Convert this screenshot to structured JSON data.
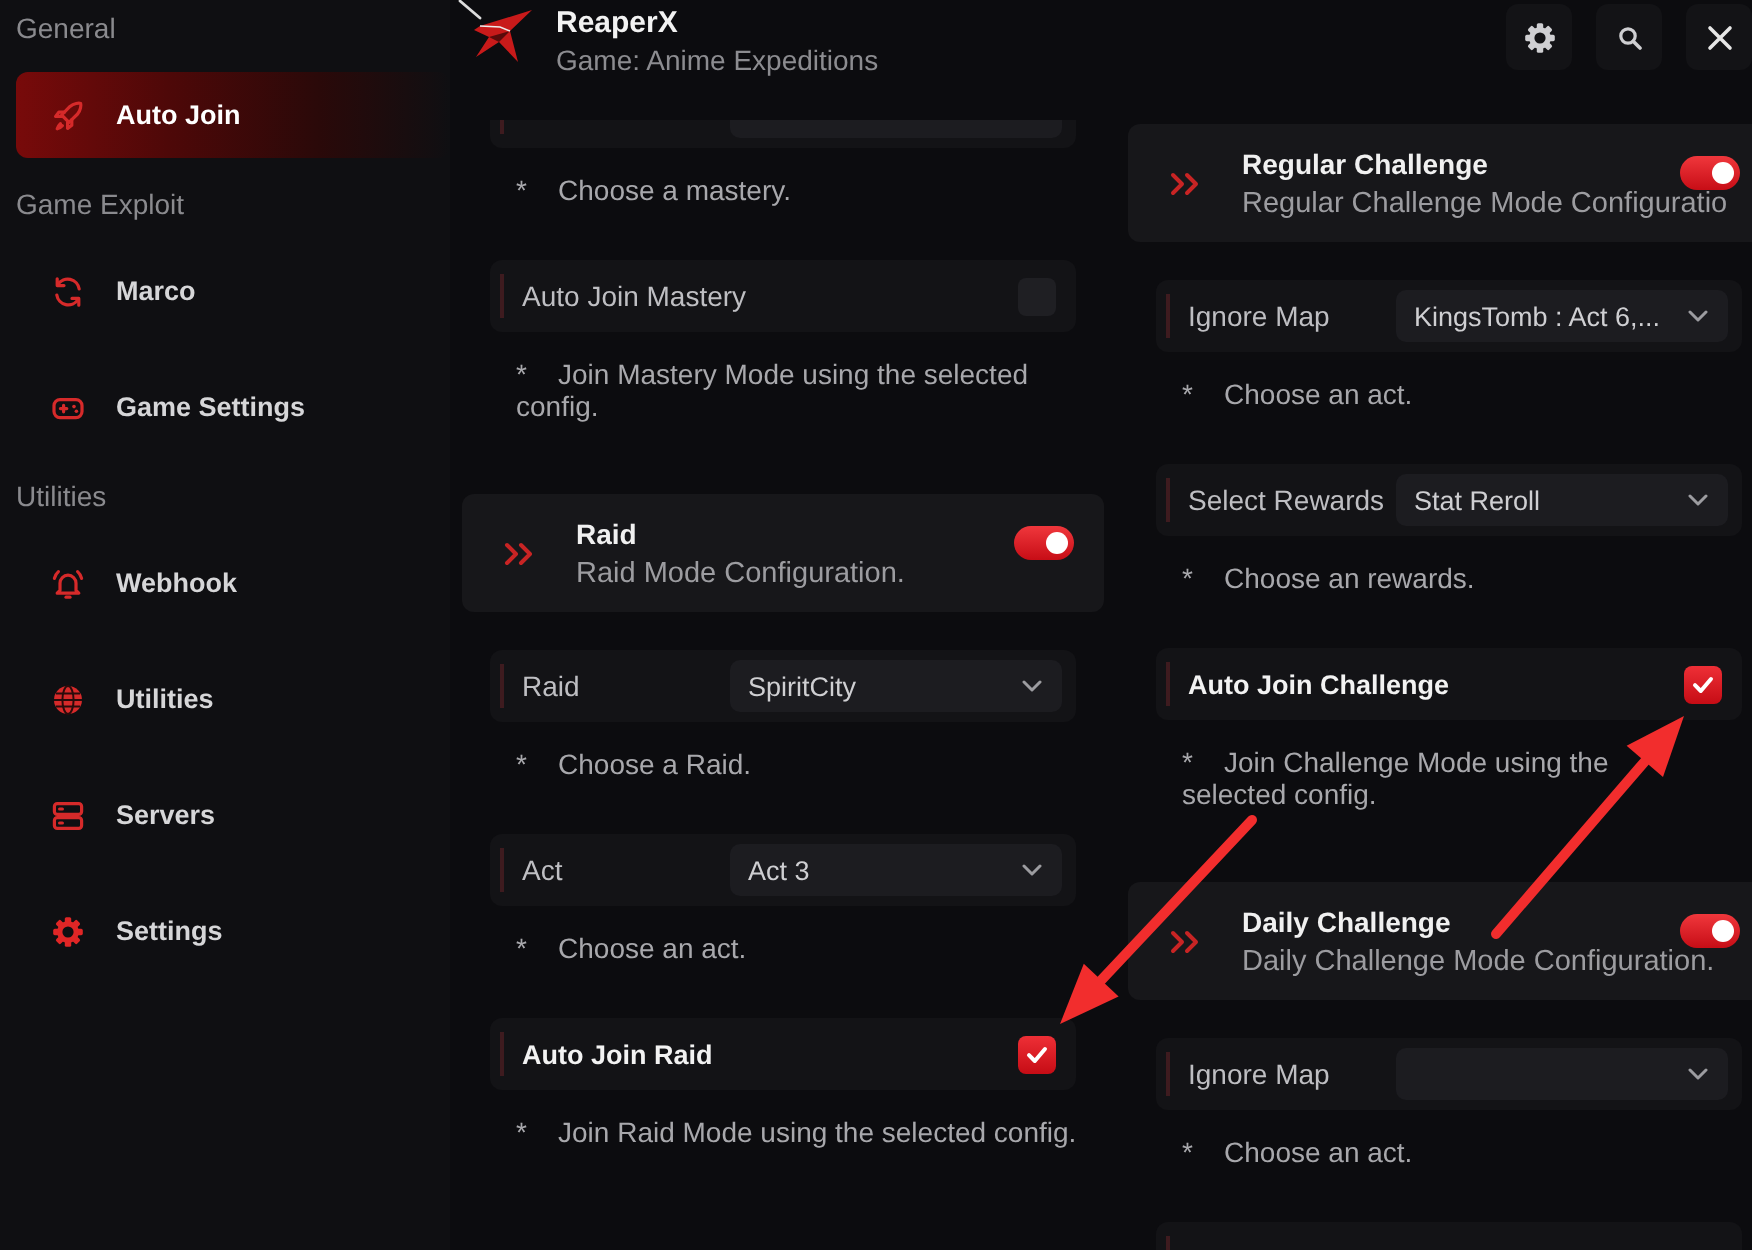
{
  "header": {
    "title": "ReaperX",
    "subtitle": "Game: Anime Expeditions"
  },
  "sidebar": {
    "groups": [
      {
        "label": "General",
        "items": [
          {
            "label": "Auto Join",
            "selected": true
          }
        ]
      },
      {
        "label": "Game Exploit",
        "items": [
          {
            "label": "Marco",
            "selected": false
          },
          {
            "label": "Game Settings",
            "selected": false
          }
        ]
      },
      {
        "label": "Utilities",
        "items": [
          {
            "label": "Webhook",
            "selected": false
          },
          {
            "label": "Utilities",
            "selected": false
          },
          {
            "label": "Servers",
            "selected": false
          },
          {
            "label": "Settings",
            "selected": false
          }
        ]
      }
    ]
  },
  "columns": [
    {
      "sections": [
        {
          "settings": [
            {
              "kind": "dropdown",
              "note": "*    Choose a mastery."
            },
            {
              "kind": "checkbox",
              "label": "Auto Join Mastery",
              "checked": false,
              "note": "*    Join Mastery Mode using the selected config."
            }
          ]
        },
        {
          "title": "Raid",
          "subtitle": "Raid Mode Configuration.",
          "on": true,
          "settings": [
            {
              "kind": "dropdown",
              "label": "Raid",
              "value": "SpiritCity",
              "note": "*    Choose a Raid."
            },
            {
              "kind": "dropdown",
              "label": "Act",
              "value": "Act 3",
              "note": "*    Choose an act."
            },
            {
              "kind": "checkbox",
              "label": "Auto Join Raid",
              "checked": true,
              "note": "*    Join Raid Mode using the selected config."
            }
          ]
        }
      ]
    },
    {
      "sections": [
        {
          "title": "Regular Challenge",
          "subtitle": "Regular Challenge Mode Configuratio",
          "on": true,
          "settings": [
            {
              "kind": "dropdown",
              "label": "Ignore Map",
              "value": "KingsTomb : Act 6,...",
              "note": "*    Choose an act."
            },
            {
              "kind": "dropdown",
              "label": "Select Rewards",
              "value": "Stat Reroll",
              "note": "*    Choose an rewards."
            },
            {
              "kind": "checkbox",
              "label": "Auto Join Challenge",
              "checked": true,
              "note": "*    Join Challenge Mode using the selected config."
            }
          ]
        },
        {
          "title": "Daily Challenge",
          "subtitle": "Daily Challenge Mode Configuration.",
          "on": true,
          "settings": [
            {
              "kind": "dropdown",
              "label": "Ignore Map",
              "note": "*    Choose an act."
            },
            {
              "kind": "blank"
            }
          ]
        }
      ]
    }
  ]
}
